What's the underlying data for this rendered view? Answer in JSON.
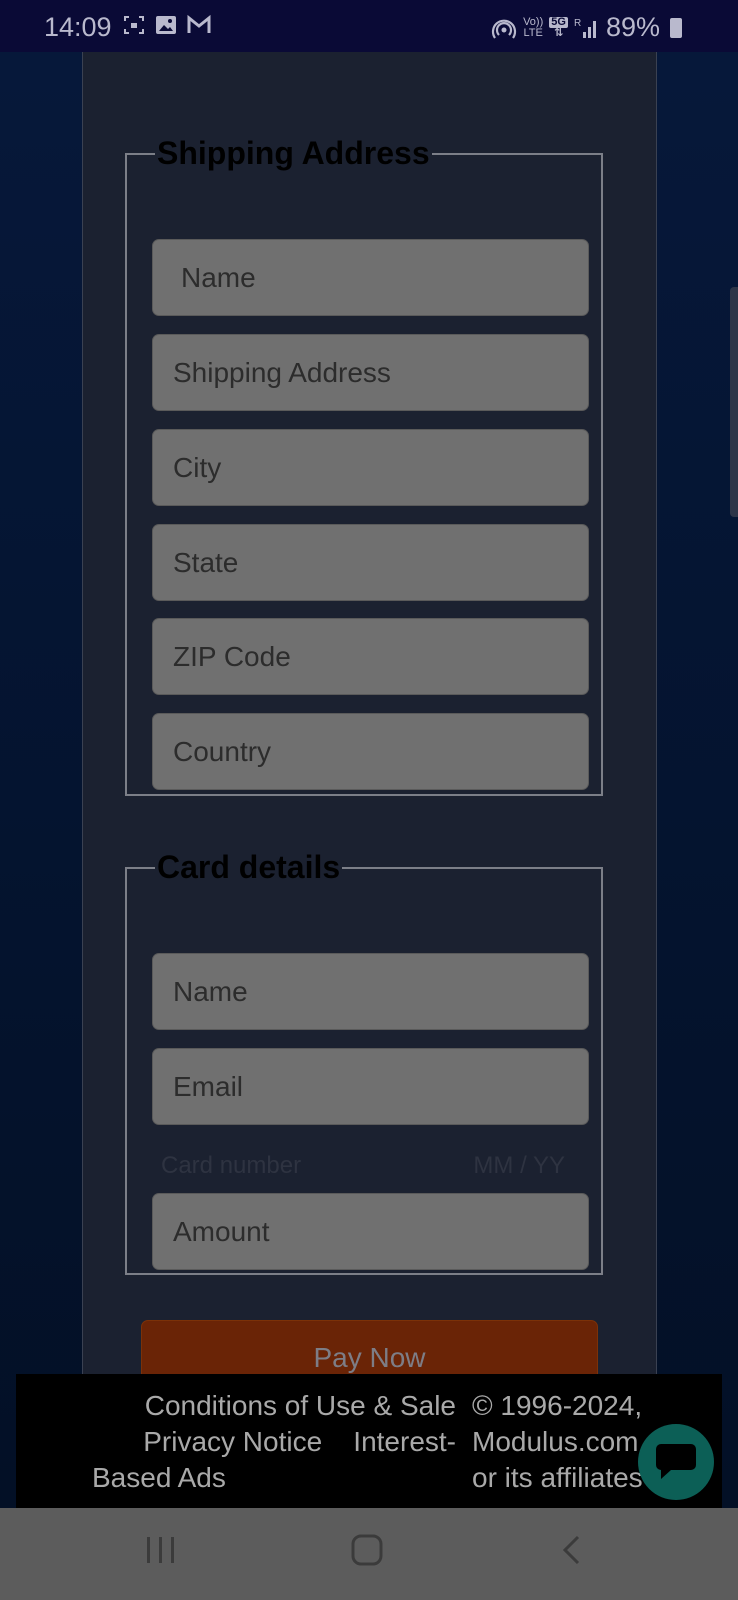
{
  "status_bar": {
    "time": "14:09",
    "left_icons": [
      "screenshot-icon",
      "gallery-icon",
      "gmail-icon"
    ],
    "right_icons": [
      "hotspot-icon",
      "volte-icon",
      "5g-icon",
      "signal-icon"
    ],
    "volte_top": "Vo))",
    "volte_bottom": "LTE",
    "net_label": "5G",
    "battery": "89%"
  },
  "shipping": {
    "legend": "Shipping Address",
    "fields": [
      {
        "placeholder": "Name"
      },
      {
        "placeholder": "Shipping Address"
      },
      {
        "placeholder": "City"
      },
      {
        "placeholder": "State"
      },
      {
        "placeholder": "ZIP Code"
      },
      {
        "placeholder": "Country"
      }
    ]
  },
  "card": {
    "legend": "Card details",
    "name_placeholder": "Name",
    "email_placeholder": "Email",
    "card_number_placeholder": "Card number",
    "expiry_placeholder": "MM / YY",
    "amount_placeholder": "Amount"
  },
  "pay_button": "Pay Now",
  "footer": {
    "link_conditions": "Conditions of Use & Sale",
    "link_privacy": "Privacy Notice",
    "link_interest": "Interest-",
    "link_interest_cont": "Based Ads",
    "copyright_line1": "© 1996-2024,",
    "copyright_line2": "Modulus.com, Inc.",
    "copyright_line3": "or its affiliates"
  },
  "nav_bar": {
    "recent_icon": "recent-apps-icon",
    "home_icon": "home-icon",
    "back_icon": "back-icon"
  }
}
